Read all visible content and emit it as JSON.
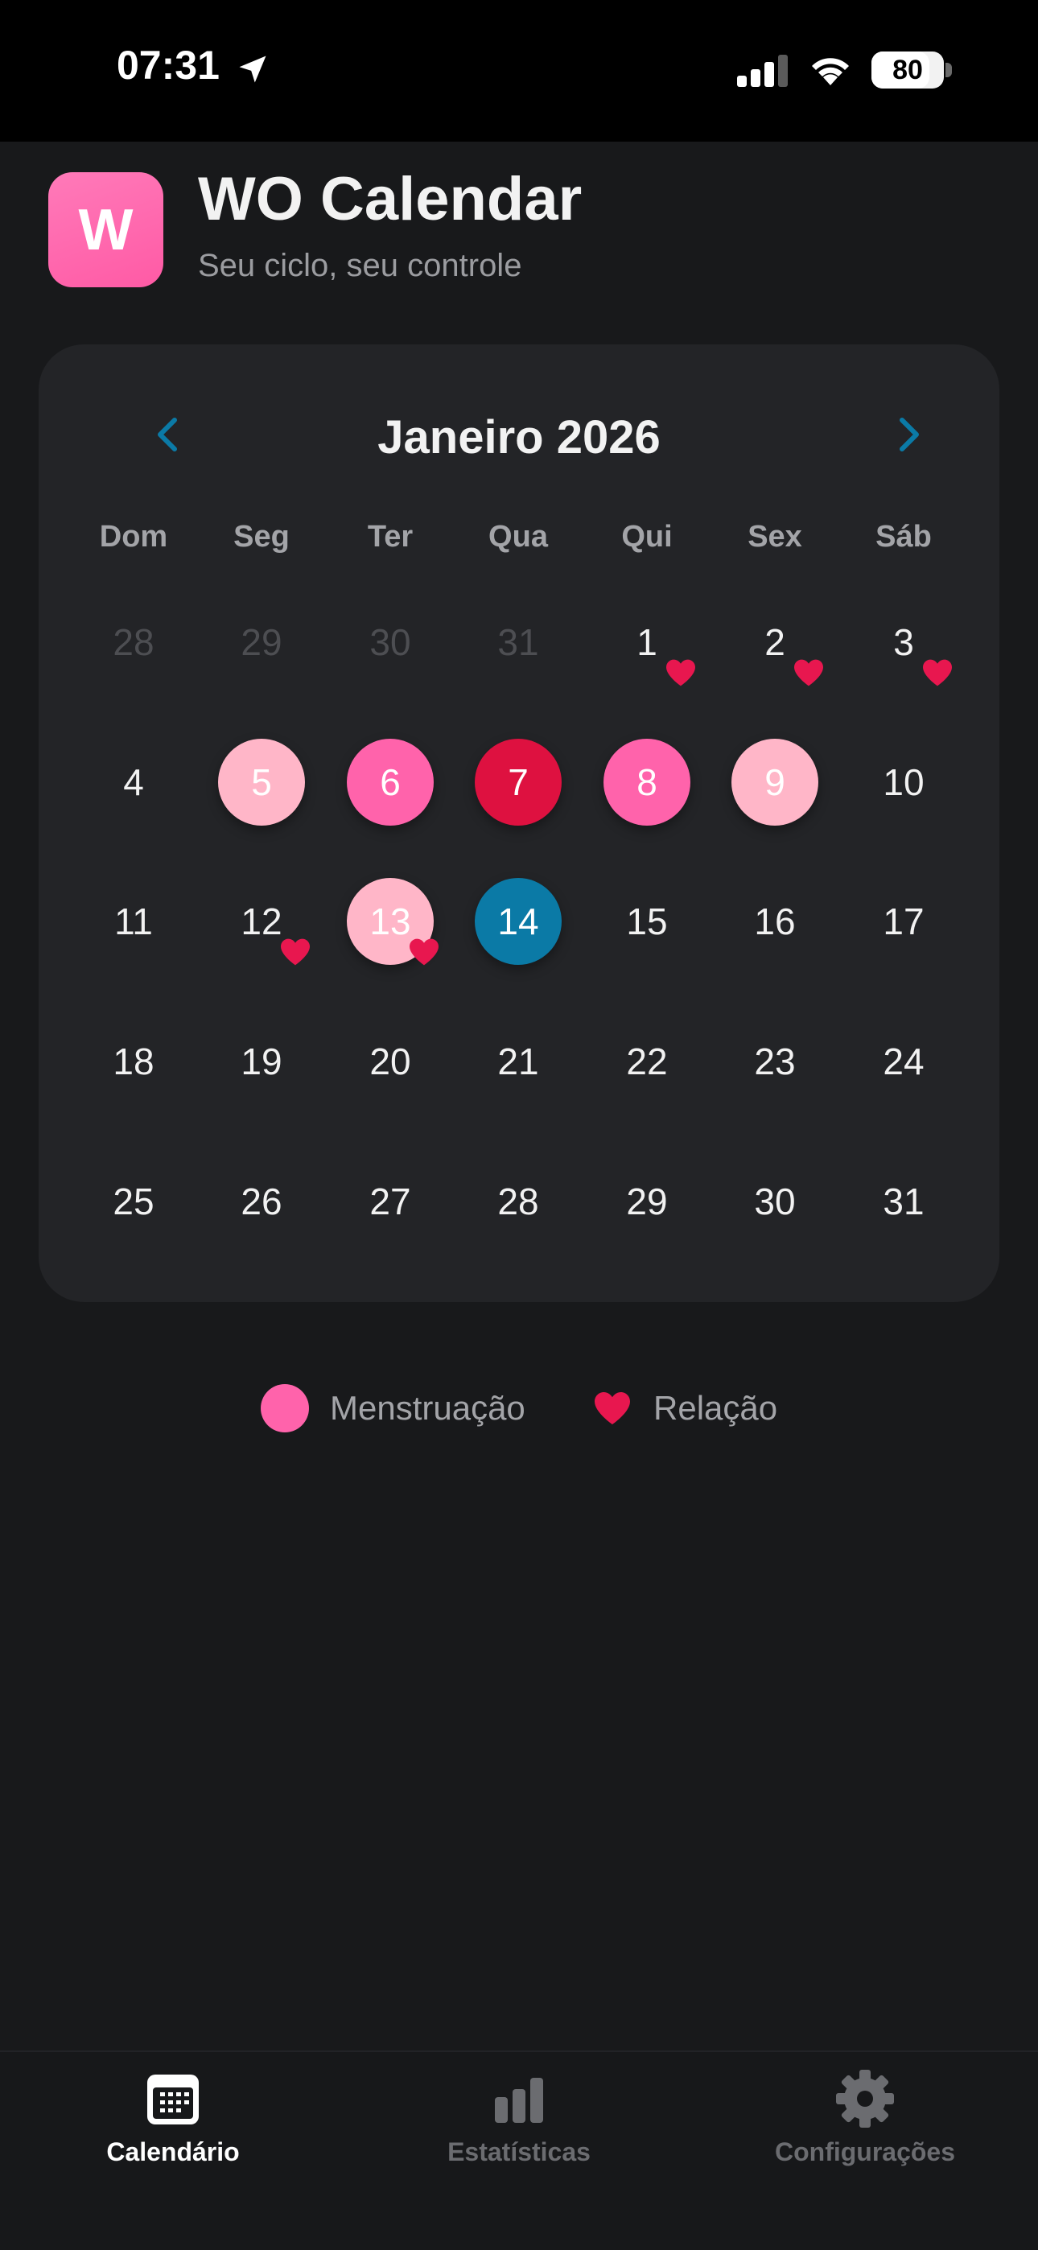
{
  "status": {
    "time": "07:31",
    "battery": "80",
    "battery_level": 0.8
  },
  "header": {
    "logo_letter": "W",
    "title": "WO Calendar",
    "subtitle": "Seu ciclo, seu controle"
  },
  "calendar": {
    "month_title": "Janeiro 2026",
    "weekdays": [
      "Dom",
      "Seg",
      "Ter",
      "Qua",
      "Qui",
      "Sex",
      "Sáb"
    ],
    "weeks": [
      [
        {
          "d": "28",
          "muted": true
        },
        {
          "d": "29",
          "muted": true
        },
        {
          "d": "30",
          "muted": true
        },
        {
          "d": "31",
          "muted": true
        },
        {
          "d": "1",
          "heart": true
        },
        {
          "d": "2",
          "heart": true
        },
        {
          "d": "3",
          "heart": true
        }
      ],
      [
        {
          "d": "4"
        },
        {
          "d": "5",
          "flow": "light"
        },
        {
          "d": "6",
          "flow": "medium"
        },
        {
          "d": "7",
          "flow": "strong"
        },
        {
          "d": "8",
          "flow": "medium"
        },
        {
          "d": "9",
          "flow": "light"
        },
        {
          "d": "10"
        }
      ],
      [
        {
          "d": "11"
        },
        {
          "d": "12",
          "heart": true
        },
        {
          "d": "13",
          "flow": "light",
          "heart": true
        },
        {
          "d": "14",
          "today": true
        },
        {
          "d": "15"
        },
        {
          "d": "16"
        },
        {
          "d": "17"
        }
      ],
      [
        {
          "d": "18"
        },
        {
          "d": "19"
        },
        {
          "d": "20"
        },
        {
          "d": "21"
        },
        {
          "d": "22"
        },
        {
          "d": "23"
        },
        {
          "d": "24"
        }
      ],
      [
        {
          "d": "25"
        },
        {
          "d": "26"
        },
        {
          "d": "27"
        },
        {
          "d": "28"
        },
        {
          "d": "29"
        },
        {
          "d": "30"
        },
        {
          "d": "31"
        }
      ]
    ]
  },
  "legend": {
    "menstruation": "Menstruação",
    "relation": "Relação"
  },
  "tabs": [
    {
      "label": "Calendário",
      "icon": "calendar-icon",
      "active": true
    },
    {
      "label": "Estatísticas",
      "icon": "bar-chart-icon",
      "active": false
    },
    {
      "label": "Configurações",
      "icon": "gear-icon",
      "active": false
    }
  ],
  "colors": {
    "accent": "#0b7aa6",
    "flow_light": "#ffb6c8",
    "flow_medium": "#ff63ab",
    "flow_strong": "#de1140",
    "heart": "#e8174f"
  }
}
